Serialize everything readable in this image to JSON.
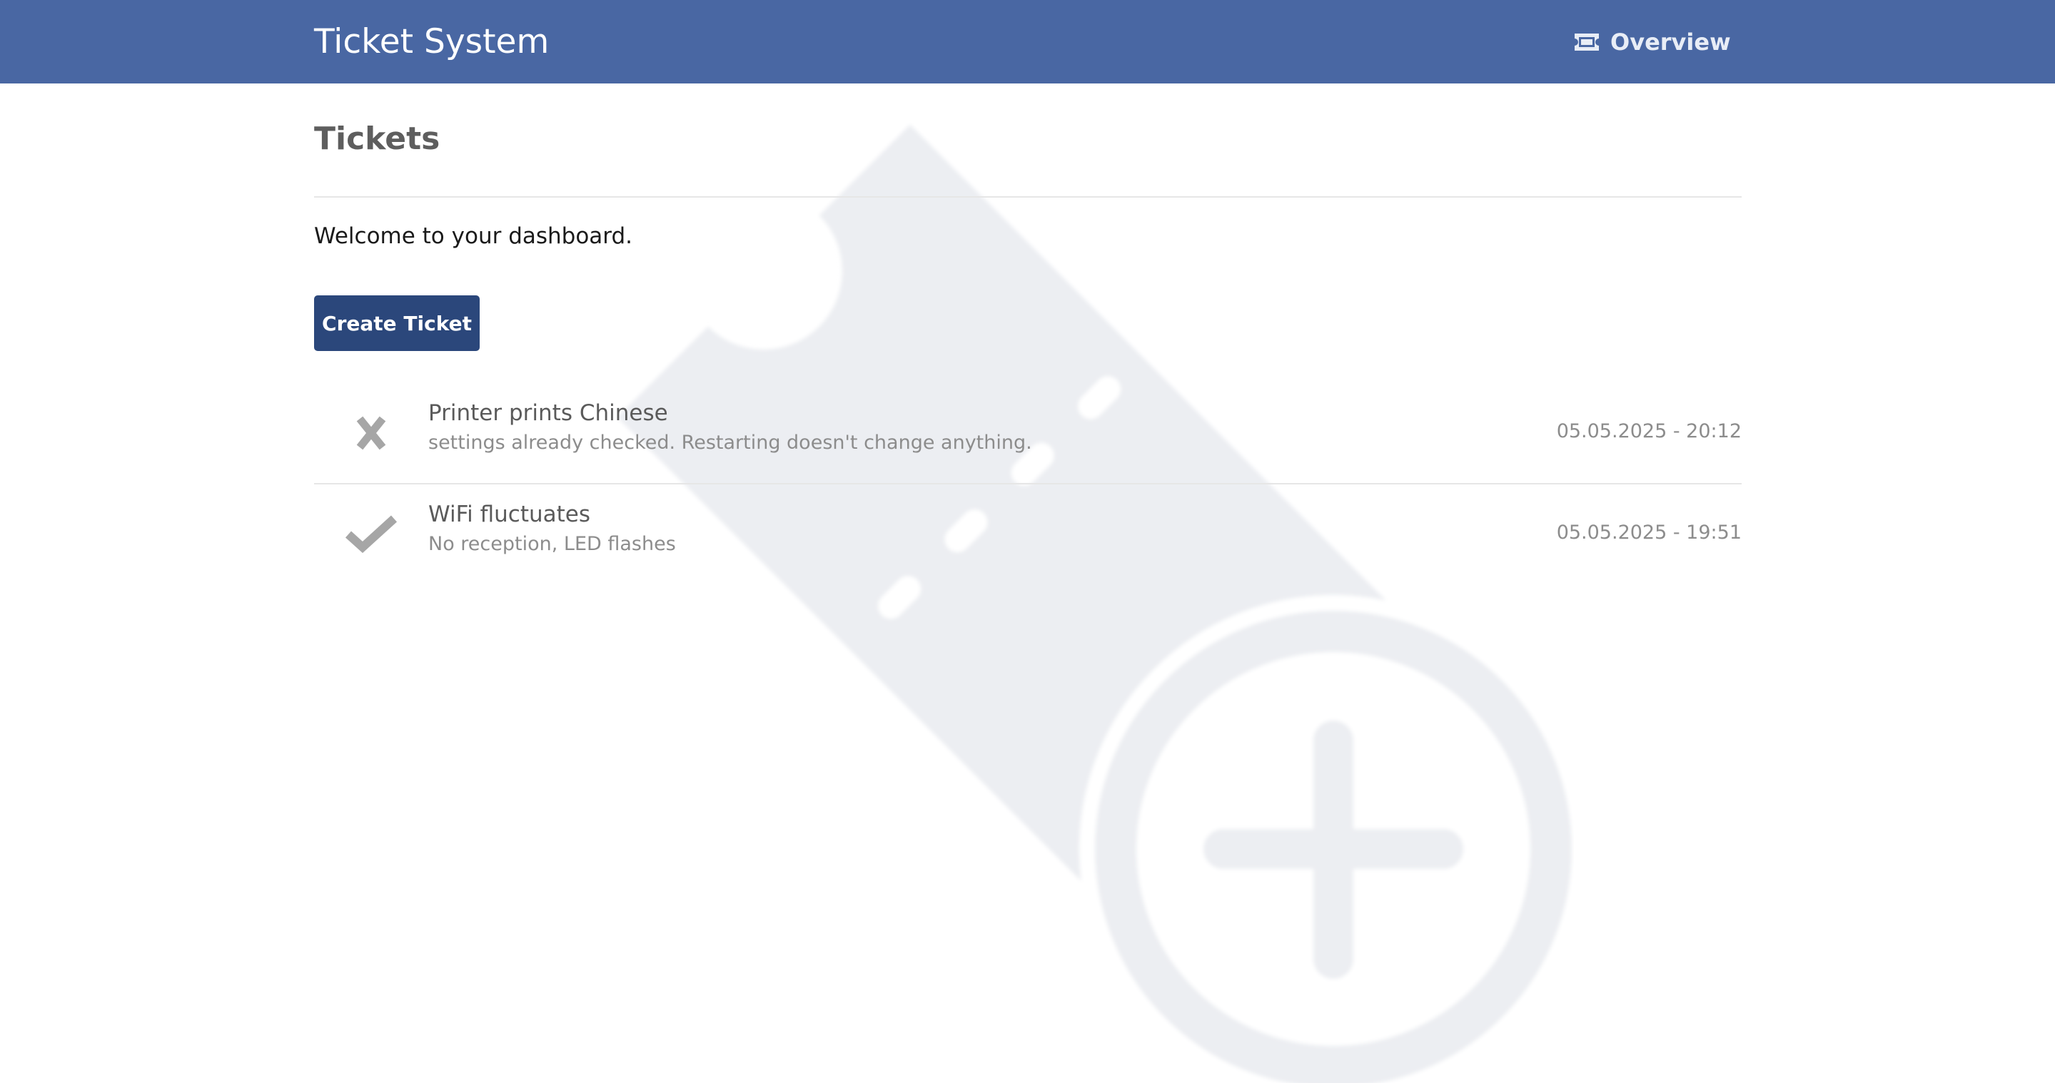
{
  "header": {
    "brand": "Ticket System",
    "nav": {
      "overview_label": "Overview",
      "overview_icon": "ticket-icon"
    },
    "background_color": "#4967a3"
  },
  "main": {
    "title": "Tickets",
    "welcome_text": "Welcome to your dashboard.",
    "create_button_label": "Create Ticket",
    "background_watermark_icon": "ticket-plus-icon"
  },
  "tickets": [
    {
      "status_icon": "cross-icon",
      "title": "Printer prints Chinese",
      "description": "settings already checked. Restarting doesn't change anything.",
      "date": "05.05.2025 - 20:12"
    },
    {
      "status_icon": "check-icon",
      "title": "WiFi fluctuates",
      "description": "No reception, LED flashes",
      "date": "05.05.2025 - 19:51"
    }
  ],
  "colors": {
    "accent": "#4967a3",
    "button": "#2b477b",
    "watermark": "#eceef2",
    "status_icon": "#a6a6a6"
  }
}
